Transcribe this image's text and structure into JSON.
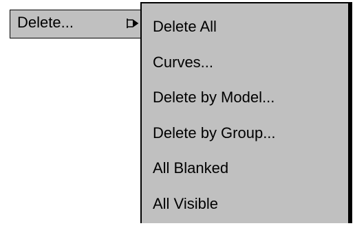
{
  "parent_menu": {
    "label": "Delete...",
    "arrow_icon": "submenu-arrow-icon"
  },
  "submenu": {
    "items": [
      {
        "label": "Delete All"
      },
      {
        "label": "Curves..."
      },
      {
        "label": "Delete by Model..."
      },
      {
        "label": "Delete by Group..."
      },
      {
        "label": "All Blanked"
      },
      {
        "label": "All Visible"
      }
    ]
  },
  "colors": {
    "menu_bg": "#c0c0c0",
    "border": "#000000",
    "text": "#000000"
  }
}
